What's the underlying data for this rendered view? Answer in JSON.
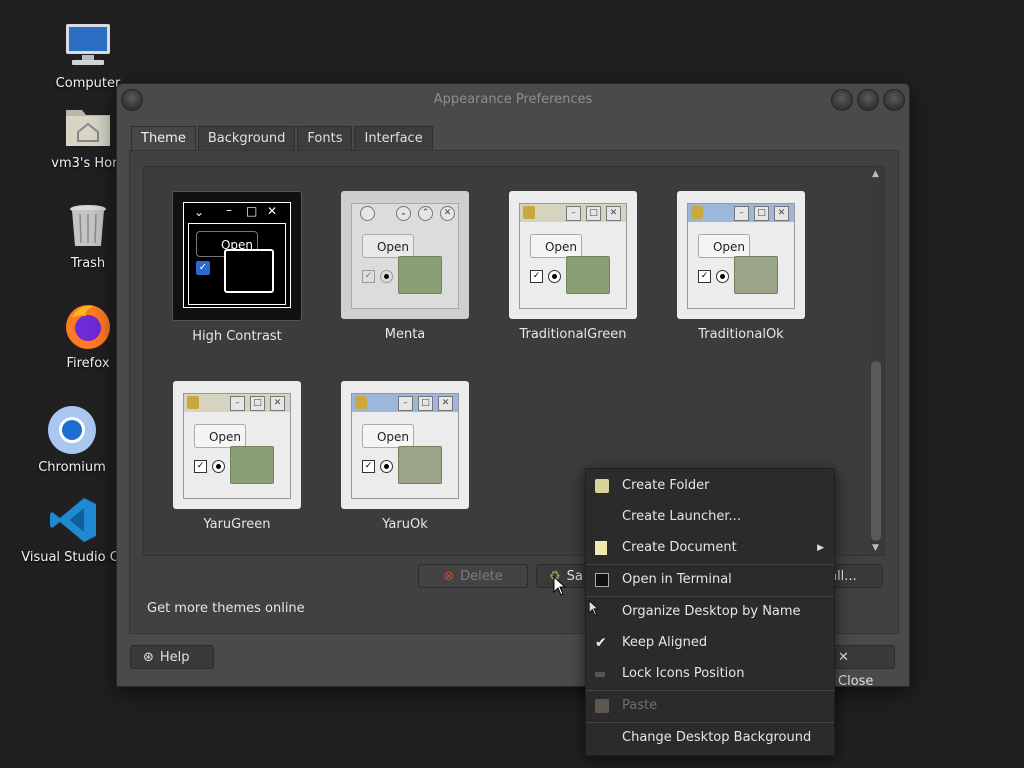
{
  "desktop": {
    "icons": [
      {
        "label": "Computer",
        "icon": "computer-icon"
      },
      {
        "label": "vm3's Hom",
        "icon": "home-folder-icon"
      },
      {
        "label": "Trash",
        "icon": "trash-icon"
      },
      {
        "label": "Firefox",
        "icon": "firefox-icon"
      },
      {
        "label": "Chromium",
        "icon": "chromium-icon"
      },
      {
        "label": "Visual Studio Co",
        "icon": "vscode-icon"
      }
    ]
  },
  "window": {
    "title": "Appearance Preferences",
    "tabs": [
      "Theme",
      "Background",
      "Fonts",
      "Interface"
    ],
    "active_tab": "Theme",
    "themes": [
      {
        "name": "High Contrast",
        "open_label": "Open"
      },
      {
        "name": "Menta",
        "open_label": "Open"
      },
      {
        "name": "TraditionalGreen",
        "open_label": "Open"
      },
      {
        "name": "TraditionalOk",
        "open_label": "Open"
      },
      {
        "name": "YaruGreen",
        "open_label": "Open"
      },
      {
        "name": "YaruOk",
        "open_label": "Open"
      }
    ],
    "buttons": {
      "delete": "Delete",
      "save": "Sa",
      "install": "tall...",
      "help": "Help",
      "close": "Close"
    },
    "get_more_link": "Get more themes online"
  },
  "context_menu": {
    "items": [
      {
        "label": "Create Folder",
        "icon": "new-folder-icon"
      },
      {
        "label": "Create Launcher...",
        "icon": ""
      },
      {
        "label": "Create Document",
        "icon": "new-document-icon",
        "submenu": true
      },
      {
        "label": "Open in Terminal",
        "icon": "terminal-icon"
      },
      {
        "label": "Organize Desktop by Name",
        "icon": ""
      },
      {
        "label": "Keep Aligned",
        "icon": "checkmark-icon",
        "checked": true
      },
      {
        "label": "Lock Icons Position",
        "icon": "lock-icon"
      },
      {
        "label": "Paste",
        "icon": "paste-icon",
        "disabled": true
      },
      {
        "label": "Change Desktop Background",
        "icon": ""
      }
    ]
  },
  "colors": {
    "desktop_bg": "#202020",
    "window_bg": "#4a4a4a",
    "menu_bg": "#2b2b2b",
    "highlight_blue": "#1e73d2"
  }
}
